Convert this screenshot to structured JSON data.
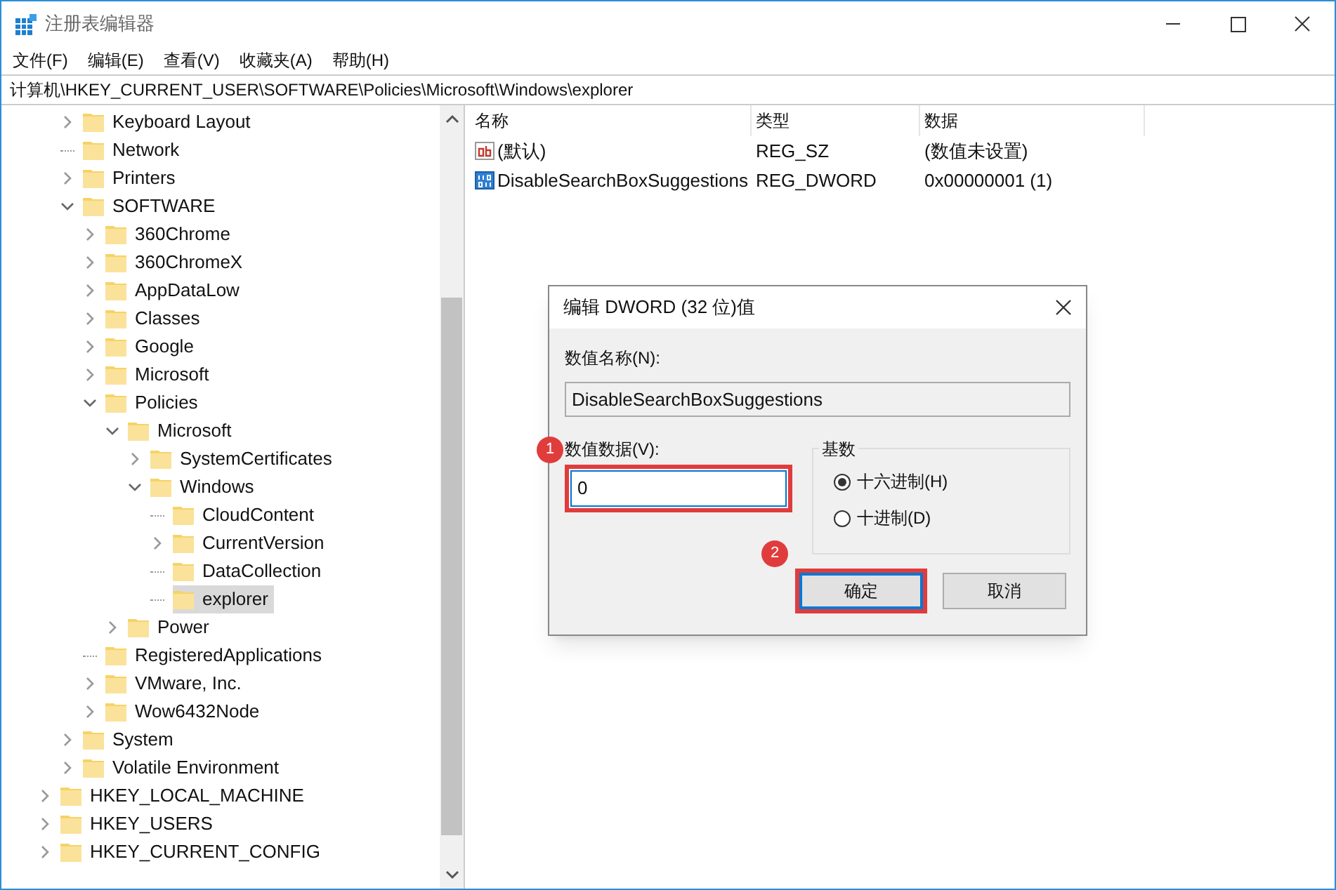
{
  "window": {
    "title": "注册表编辑器"
  },
  "menu": [
    "文件(F)",
    "编辑(E)",
    "查看(V)",
    "收藏夹(A)",
    "帮助(H)"
  ],
  "address": "计算机\\HKEY_CURRENT_USER\\SOFTWARE\\Policies\\Microsoft\\Windows\\explorer",
  "tree": {
    "current_user_children": [
      {
        "label": "Keyboard Layout",
        "expanded": false,
        "selected": false
      },
      {
        "label": "Network",
        "selected": false
      },
      {
        "label": "Printers",
        "expanded": false,
        "selected": false
      },
      {
        "label": "SOFTWARE",
        "expanded": true,
        "selected": false,
        "children": [
          {
            "label": "360Chrome",
            "expanded": false,
            "selected": false
          },
          {
            "label": "360ChromeX",
            "expanded": false,
            "selected": false
          },
          {
            "label": "AppDataLow",
            "expanded": false,
            "selected": false
          },
          {
            "label": "Classes",
            "expanded": false,
            "selected": false
          },
          {
            "label": "Google",
            "expanded": false,
            "selected": false
          },
          {
            "label": "Microsoft",
            "expanded": false,
            "selected": false
          },
          {
            "label": "Policies",
            "expanded": true,
            "selected": false,
            "children": [
              {
                "label": "Microsoft",
                "expanded": true,
                "selected": false,
                "children": [
                  {
                    "label": "SystemCertificates",
                    "expanded": false,
                    "selected": false
                  },
                  {
                    "label": "Windows",
                    "expanded": true,
                    "selected": false,
                    "children": [
                      {
                        "label": "CloudContent",
                        "selected": false
                      },
                      {
                        "label": "CurrentVersion",
                        "expanded": false,
                        "selected": false
                      },
                      {
                        "label": "DataCollection",
                        "selected": false
                      },
                      {
                        "label": "explorer",
                        "selected": true
                      }
                    ]
                  }
                ]
              },
              {
                "label": "Power",
                "expanded": false,
                "selected": false
              }
            ]
          },
          {
            "label": "RegisteredApplications",
            "selected": false
          },
          {
            "label": "VMware, Inc.",
            "expanded": false,
            "selected": false
          },
          {
            "label": "Wow6432Node",
            "expanded": false,
            "selected": false
          }
        ]
      },
      {
        "label": "System",
        "expanded": false,
        "selected": false
      },
      {
        "label": "Volatile Environment",
        "expanded": false,
        "selected": false
      }
    ],
    "roots": [
      {
        "label": "HKEY_LOCAL_MACHINE",
        "expanded": false,
        "selected": false
      },
      {
        "label": "HKEY_USERS",
        "expanded": false,
        "selected": false
      },
      {
        "label": "HKEY_CURRENT_CONFIG",
        "expanded": false,
        "selected": false
      }
    ]
  },
  "values_table": {
    "columns": [
      "名称",
      "类型",
      "数据"
    ],
    "rows": [
      {
        "kind": "string",
        "name": "(默认)",
        "type": "REG_SZ",
        "data": "(数值未设置)"
      },
      {
        "kind": "binary",
        "name": "DisableSearchBoxSuggestions",
        "type": "REG_DWORD",
        "data": "0x00000001 (1)"
      }
    ]
  },
  "dialog": {
    "title": "编辑 DWORD (32 位)值",
    "name_label": "数值名称(N):",
    "name_value": "DisableSearchBoxSuggestions",
    "data_label": "数值数据(V):",
    "data_value": "0",
    "data_highlighted": true,
    "data_step": "1",
    "base_label": "基数",
    "bases": [
      {
        "label": "十六进制(H)",
        "selected": true
      },
      {
        "label": "十进制(D)",
        "selected": false
      }
    ],
    "buttons": [
      {
        "label": "确定",
        "default": true,
        "highlighted": true,
        "step": "2"
      },
      {
        "label": "取消",
        "default": false,
        "highlighted": false
      }
    ]
  }
}
